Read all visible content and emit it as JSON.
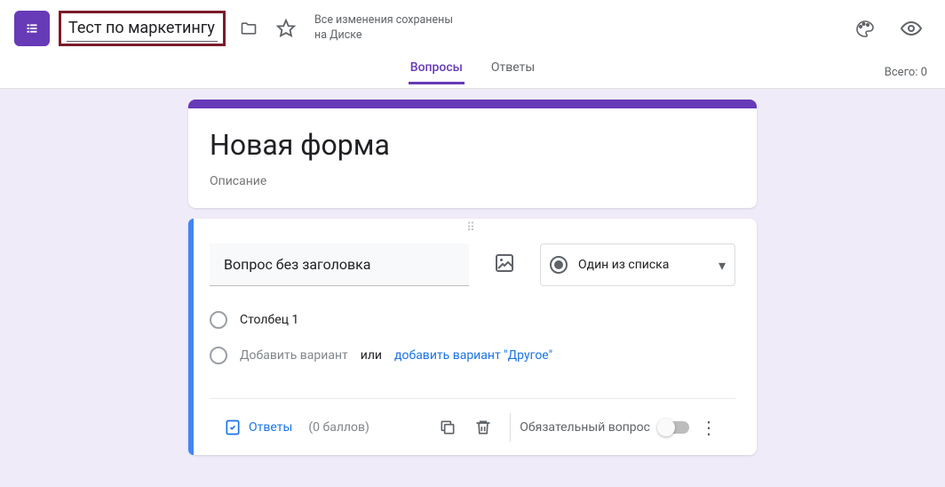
{
  "header": {
    "doc_title": "Тест по маркетингу",
    "save_status": "Все изменения сохранены\nна Диске"
  },
  "tabs": {
    "questions": "Вопросы",
    "responses": "Ответы",
    "total": "Всего: 0"
  },
  "form": {
    "title": "Новая форма",
    "desc_placeholder": "Описание"
  },
  "question": {
    "title": "Вопрос без заголовка",
    "type_label": "Один из списка",
    "option1": "Столбец 1",
    "add_option": "Добавить вариант",
    "add_or": "или",
    "add_other": "добавить вариант \"Другое\""
  },
  "footer": {
    "answers": "Ответы",
    "points": "(0 баллов)",
    "required": "Обязательный вопрос"
  }
}
